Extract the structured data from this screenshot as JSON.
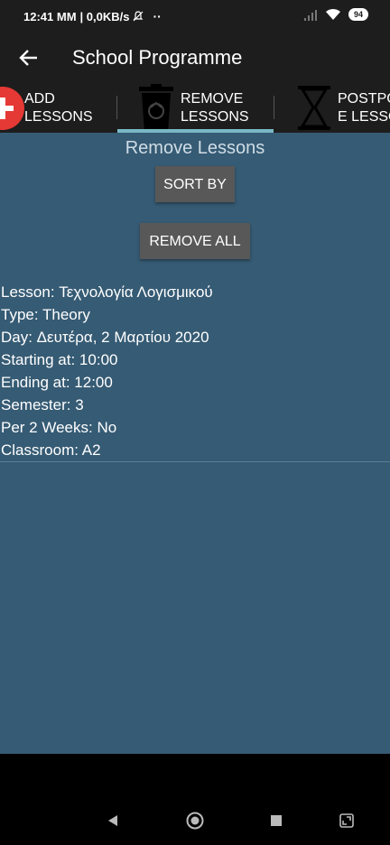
{
  "status_bar": {
    "time": "12:41 MM",
    "network_speed": "| 0,0KB/s",
    "battery": "94",
    "icons": [
      "bell-off-icon",
      "more-dots-icon",
      "signal-icon",
      "wifi-icon",
      "battery-icon"
    ]
  },
  "app_bar": {
    "title": "School Programme",
    "back_icon": "arrow-left-icon"
  },
  "tabs": [
    {
      "label": "ADD\nLESSONS",
      "icon": "add-circle-icon",
      "selected": false
    },
    {
      "label": "REMOVE\nLESSONS",
      "icon": "recycle-bin-icon",
      "selected": true
    },
    {
      "label": "POSTPO\nE LESSO",
      "icon": "hourglass-icon",
      "selected": false
    }
  ],
  "colors": {
    "accent": "#79b8c6",
    "content_bg": "#365b74",
    "bar_bg": "#1d1d1d",
    "button_bg": "#585858",
    "add_icon": "#e53935"
  },
  "main": {
    "section_title": "Remove Lessons",
    "sort_button": "SORT BY",
    "remove_all_button": "REMOVE ALL"
  },
  "lessons": [
    {
      "lesson": "Lesson: Τεχνολογία Λογισμικού",
      "type": "Type: Theory",
      "day": "Day: Δευτέρα, 2 Μαρτίου 2020",
      "start": "Starting at: 10:00",
      "end": "Ending at: 12:00",
      "semester": "Semester: 3",
      "per2weeks": "Per 2 Weeks: No",
      "classroom": "Classroom: A2"
    }
  ],
  "nav_bar": {
    "icons": [
      "back-triangle-icon",
      "home-circle-icon",
      "recents-square-icon",
      "rotate-screen-icon"
    ]
  }
}
